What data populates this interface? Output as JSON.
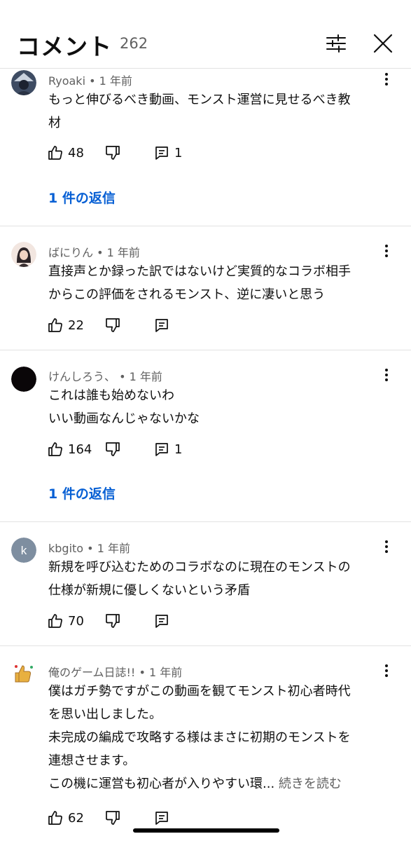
{
  "header": {
    "title": "コメント",
    "count": "262"
  },
  "icons": {
    "filter": "sliders-icon",
    "close": "close-icon",
    "like": "thumb-up-icon",
    "dislike": "thumb-down-icon",
    "reply": "reply-icon",
    "more": "more-vert-icon"
  },
  "colors": {
    "link": "#065fd4",
    "meta": "#606060",
    "divider": "#e2e2e2"
  },
  "comments": [
    {
      "author": "Ryoaki",
      "time": "1 年前",
      "lines": [
        "もっと伸びるべき動画、モンスト運営に見せるべき教",
        "材"
      ],
      "likes": "48",
      "reply_count": "1",
      "replies_label": "1 件の返信",
      "avatar_color": "#4a5a70"
    },
    {
      "author": "ばにりん",
      "time": "1 年前",
      "lines": [
        "直接声とか録った訳ではないけど実質的なコラボ相手",
        "からこの評価をされるモンスト、逆に凄いと思う"
      ],
      "likes": "22",
      "reply_count": "",
      "avatar_color": "#3a3032"
    },
    {
      "author": "けんしろう、",
      "time": "1 年前",
      "lines": [
        "これは誰も始めないわ",
        "いい動画なんじゃないかな"
      ],
      "likes": "164",
      "reply_count": "1",
      "replies_label": "1 件の返信",
      "avatar_color": "#0a0608"
    },
    {
      "author": "kbgito",
      "time": "1 年前",
      "avatar_letter": "k",
      "lines": [
        "新規を呼び込むためのコラボなのに現在のモンストの",
        "仕様が新規に優しくないという矛盾"
      ],
      "likes": "70",
      "reply_count": "",
      "avatar_color": "#7e8ea0"
    },
    {
      "author": "俺のゲーム日誌!!",
      "time": "1 年前",
      "lines": [
        "僕はガチ勢ですがこの動画を観てモンスト初心者時代",
        "を思い出しました。",
        "未完成の編成で攻略する様はまさに初期のモンストを",
        "連想させます。",
        "この機に運営も初心者が入りやすい環..."
      ],
      "read_more": "続きを読む",
      "likes": "62",
      "reply_count": "",
      "avatar_color": "#e8b040"
    }
  ]
}
